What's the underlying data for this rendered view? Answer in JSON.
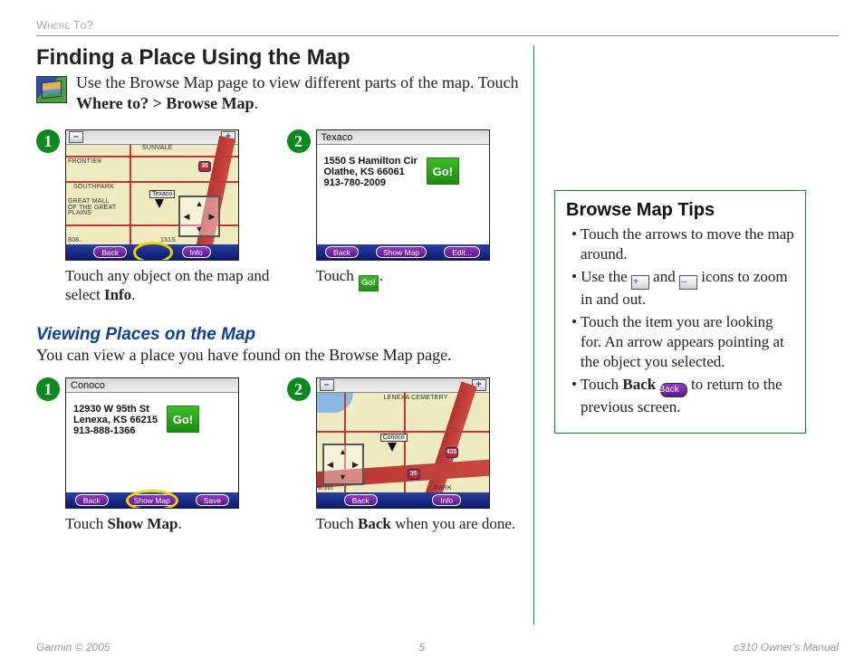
{
  "header": {
    "section": "Where To?"
  },
  "h1": "Finding a Place Using the Map",
  "intro": {
    "text_a": "Use the Browse Map page to view different parts of the map. Touch ",
    "bold": "Where to? > Browse Map",
    "text_b": "."
  },
  "stepsA": {
    "s1": {
      "screenshot": {
        "minus": "–",
        "plus": "+",
        "labels": {
          "sunvale": "SUNVALE",
          "frontier": "FRONTIER",
          "southpark": "SOUTHPARK",
          "great": "GREAT MALL OF\nTHE GREAT\nPLAINS",
          "scale": "808..",
          "e151": "151S",
          "i35": "35",
          "texaco": "Texaco"
        },
        "buttons": {
          "back": "Back",
          "info": "Info"
        }
      },
      "caption_a": "Touch any object on the map and select ",
      "caption_bold": "Info",
      "caption_b": "."
    },
    "s2": {
      "screenshot": {
        "title": "Texaco",
        "addr_line1": "1550 S Hamilton Cir",
        "addr_line2": "Olathe, KS 66061",
        "addr_line3": "913-780-2009",
        "go": "Go!",
        "buttons": {
          "back": "Back",
          "showmap": "Show Map",
          "edit": "Edit..."
        }
      },
      "caption_a": "Touch ",
      "caption_go": "Go!",
      "caption_b": "."
    }
  },
  "h2": "Viewing Places on the Map",
  "lead": "You can view a place you have found on the Browse Map page.",
  "stepsB": {
    "s1": {
      "screenshot": {
        "title": "Conoco",
        "addr_line1": "12930 W 95th St",
        "addr_line2": "Lenexa, KS 66215",
        "addr_line3": "913-888-1366",
        "go": "Go!",
        "buttons": {
          "back": "Back",
          "showmap": "Show Map",
          "save": "Save"
        }
      },
      "caption_a": "Touch ",
      "caption_bold": "Show Map",
      "caption_b": "."
    },
    "s2": {
      "screenshot": {
        "minus": "–",
        "plus": "+",
        "labels": {
          "lenexa": "LENEXA CEMETERY",
          "conoco": "Conoco",
          "park": "PARK",
          "i35": "35",
          "i435": "435",
          "scale": "0.3m"
        },
        "buttons": {
          "back": "Back",
          "info": "Info"
        }
      },
      "caption_a": "Touch ",
      "caption_bold": "Back",
      "caption_b": " when you are done."
    }
  },
  "tips": {
    "title": "Browse Map Tips",
    "items": {
      "t1": "Touch the arrows to move the map around.",
      "t2a": "Use the ",
      "t2b": " and ",
      "t2c": " icons to zoom in and out.",
      "plus": "+",
      "minus": "–",
      "t3": "Touch the item you are looking for. An arrow appears pointing at the object you selected.",
      "t4a": "Touch ",
      "t4bold": "Back",
      "t4btn": "Back",
      "t4b": " to return to the previous screen."
    }
  },
  "footer": {
    "left": "Garmin © 2005",
    "center": "5",
    "right": "c310 Owner's Manual"
  },
  "bullets": {
    "one": "➊",
    "two": "➋"
  }
}
